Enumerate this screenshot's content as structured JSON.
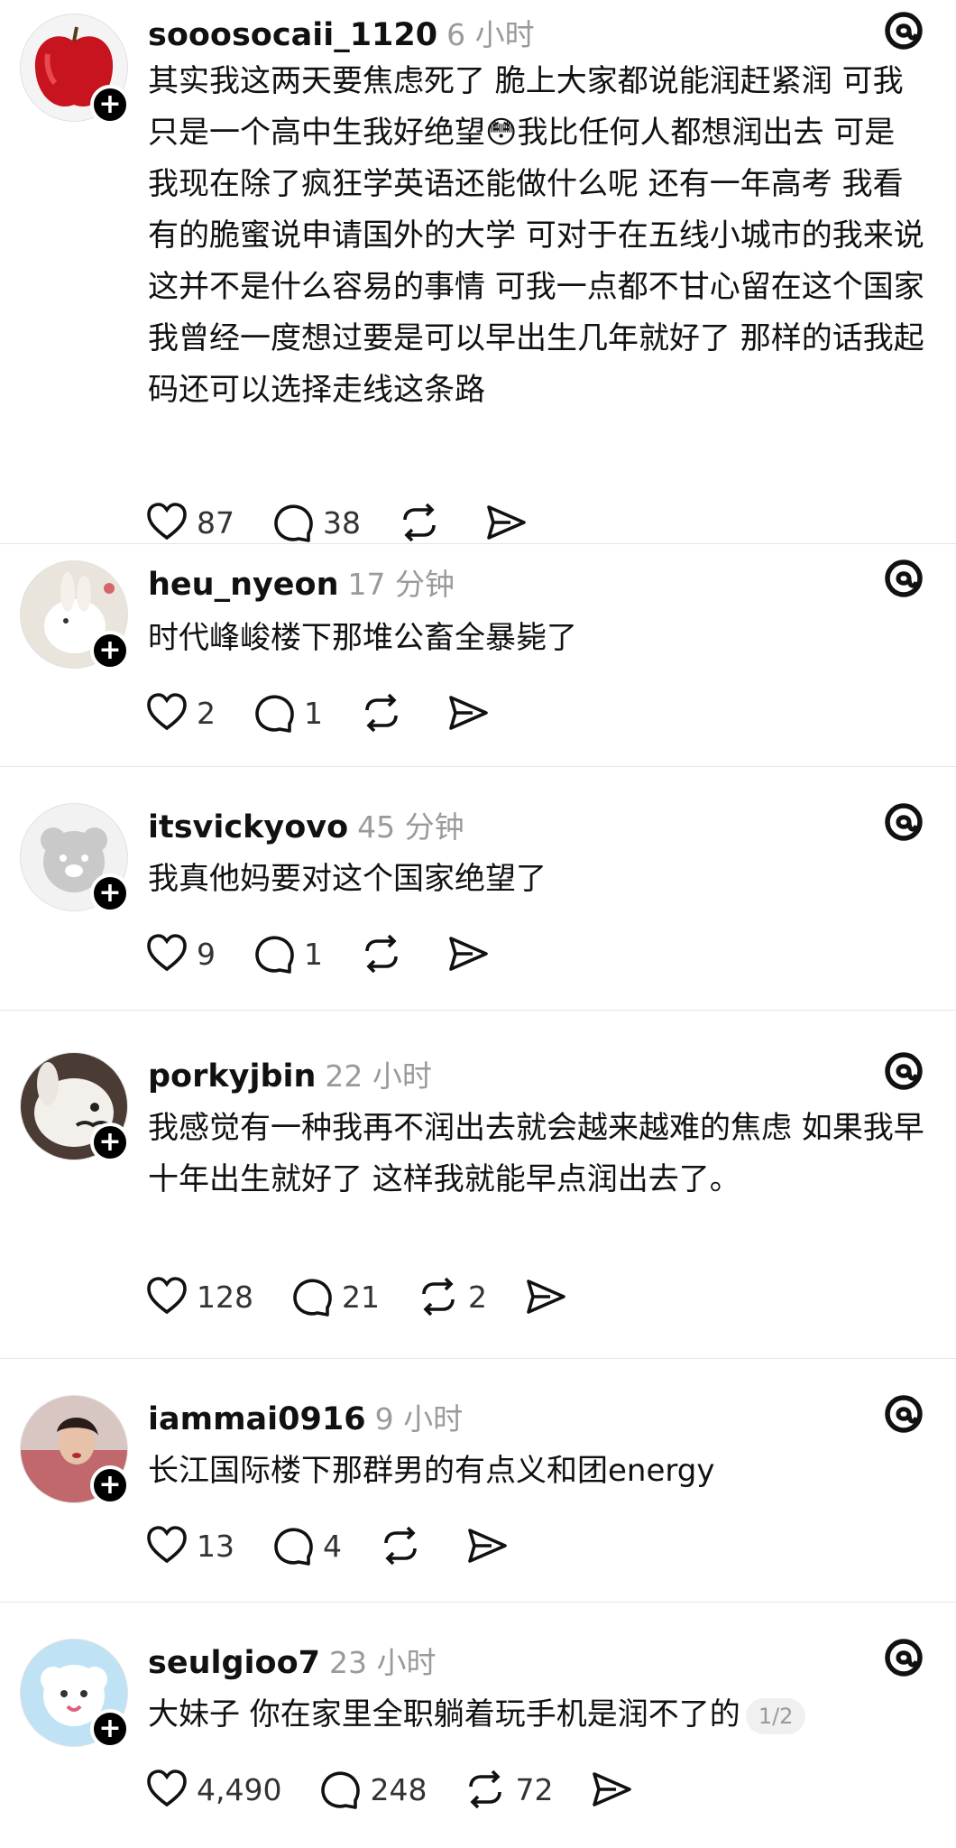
{
  "posts": [
    {
      "username": "sooosocaii_1120",
      "time": "6 小时",
      "text": "其实我这两天要焦虑死了 脆上大家都说能润赶紧润 可我只是一个高中生我好绝望😳我比任何人都想润出去 可是我现在除了疯狂学英语还能做什么呢 还有一年高考 我看有的脆蜜说申请国外的大学 可对于在五线小城市的我来说这并不是什么容易的事情 可我一点都不甘心留在这个国家 我曾经一度想过要是可以早出生几年就好了 那样的话我起码还可以选择走线这条路",
      "likes": "87",
      "replies": "38",
      "reposts": "",
      "avatar": "apple"
    },
    {
      "username": "heu_nyeon",
      "time": "17 分钟",
      "text": "时代峰峻楼下那堆公畜全暴毙了",
      "likes": "2",
      "replies": "1",
      "reposts": "",
      "avatar": "rabbit"
    },
    {
      "username": "itsvickyovo",
      "time": "45 分钟",
      "text": "我真他妈要对这个国家绝望了",
      "likes": "9",
      "replies": "1",
      "reposts": "",
      "avatar": "bear"
    },
    {
      "username": "porkyjbin",
      "time": "22 小时",
      "text": "我感觉有一种我再不润出去就会越来越难的焦虑 如果我早十年出生就好了 这样我就能早点润出去了。",
      "likes": "128",
      "replies": "21",
      "reposts": "2",
      "avatar": "bunny"
    },
    {
      "username": "iammai0916",
      "time": "9 小时",
      "text": "长江国际楼下那群男的有点义和团energy",
      "likes": "13",
      "replies": "4",
      "reposts": "",
      "avatar": "girl"
    },
    {
      "username": "seulgioo7",
      "time": "23 小时",
      "text": "大妹子 你在家里全职躺着玩手机是润不了的",
      "page": "1/2",
      "likes": "4,490",
      "replies": "248",
      "reposts": "72",
      "avatar": "sheep"
    }
  ]
}
